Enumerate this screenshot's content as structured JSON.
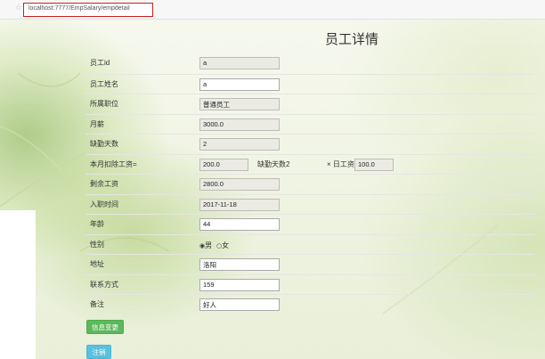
{
  "browser": {
    "url": "localhost:7777/EmpSalary/empdetail",
    "bookmark_icon": "star-icon"
  },
  "page": {
    "title": "员工详情"
  },
  "form": {
    "emp_id": {
      "label": "员工id",
      "value": "a"
    },
    "emp_name": {
      "label": "员工姓名",
      "value": "a"
    },
    "position": {
      "label": "所属职位",
      "value": "普通员工"
    },
    "monthly_salary": {
      "label": "月薪",
      "value": "3000.0"
    },
    "absent_days": {
      "label": "缺勤天数",
      "value": "2"
    },
    "deduction": {
      "label": "本月扣除工资=",
      "value": "200.0",
      "absent_text": "缺勤天数2",
      "times_text": "× 日工资",
      "daily_wage": "100.0"
    },
    "remaining_salary": {
      "label": "剩余工资",
      "value": "2800.0"
    },
    "hire_date": {
      "label": "入职时间",
      "value": "2017-11-18"
    },
    "age": {
      "label": "年龄",
      "value": "44"
    },
    "gender": {
      "label": "性别",
      "male": "男",
      "female": "女"
    },
    "address": {
      "label": "地址",
      "value": "洛阳"
    },
    "contact": {
      "label": "联系方式",
      "value": "159"
    },
    "remark": {
      "label": "备注",
      "value": "好人"
    }
  },
  "buttons": {
    "update": "信息变更",
    "cancel": "注销"
  },
  "colors": {
    "url_highlight": "#cc1f1f",
    "btn_green": "#5cb85c",
    "btn_blue": "#5bc0de"
  }
}
